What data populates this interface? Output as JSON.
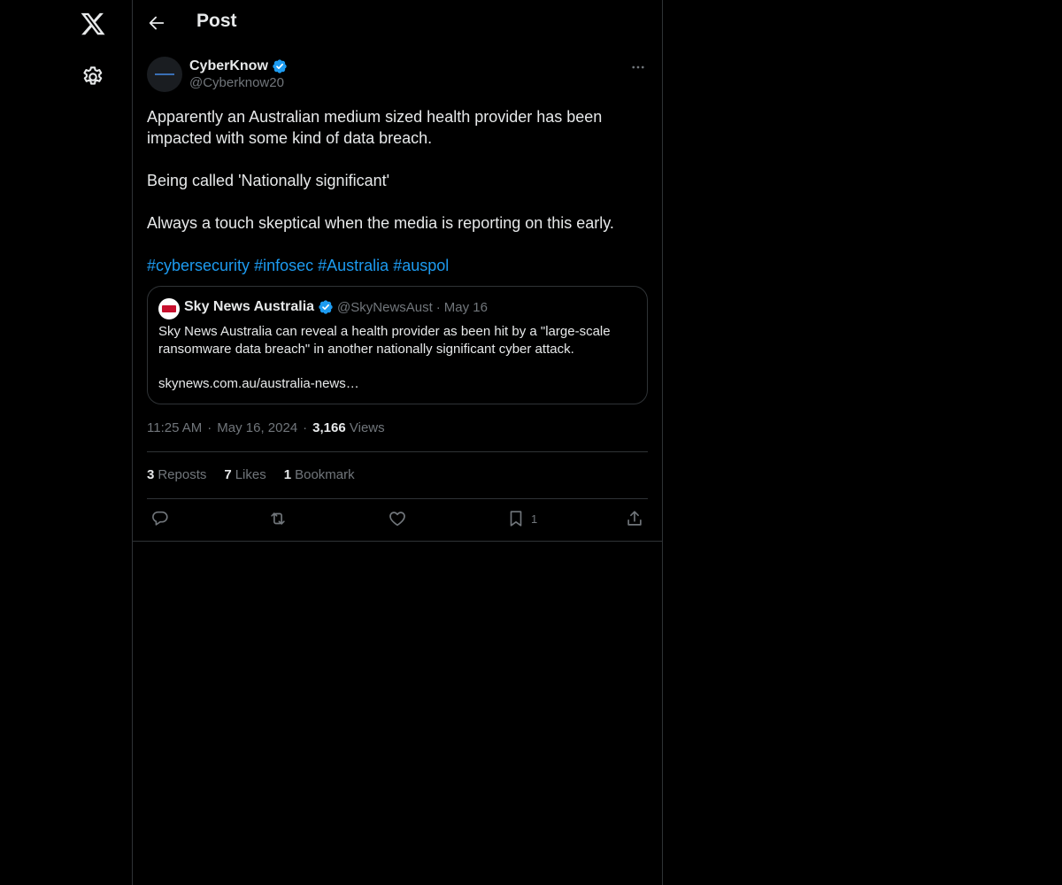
{
  "header": {
    "title": "Post"
  },
  "post": {
    "author_name": "CyberKnow",
    "author_handle": "@Cyberknow20",
    "paragraphs": [
      "Apparently an Australian medium sized health provider has been impacted with some kind of data breach.",
      "Being called 'Nationally significant'",
      "Always a touch skeptical when the media is reporting on this early."
    ],
    "hashtags": [
      "#cybersecurity",
      "#infosec",
      "#Australia",
      "#auspol"
    ],
    "time": "11:25 AM",
    "date": "May 16, 2024",
    "views_count": "3,166",
    "views_label": "Views",
    "separator": "·"
  },
  "quote": {
    "name": "Sky News Australia",
    "handle": "@SkyNewsAust",
    "separator": "·",
    "date": "May 16",
    "text": "Sky News Australia can reveal a health provider as been hit by a \"large-scale ransomware data breach\" in another nationally significant cyber attack.",
    "link": "skynews.com.au/australia-news…"
  },
  "stats": {
    "reposts_count": "3",
    "reposts_label": "Reposts",
    "likes_count": "7",
    "likes_label": "Likes",
    "bookmarks_count": "1",
    "bookmarks_label": "Bookmark"
  },
  "actions": {
    "bookmark_count": "1"
  },
  "colors": {
    "background": "#000000",
    "text": "#e7e9ea",
    "muted": "#71767b",
    "accent": "#1d9bf0",
    "border": "#2f3336"
  },
  "icons": [
    "x-logo-icon",
    "settings-icon",
    "back-arrow-icon",
    "verified-icon",
    "more-icon",
    "reply-icon",
    "repost-icon",
    "like-icon",
    "bookmark-icon",
    "share-icon"
  ]
}
